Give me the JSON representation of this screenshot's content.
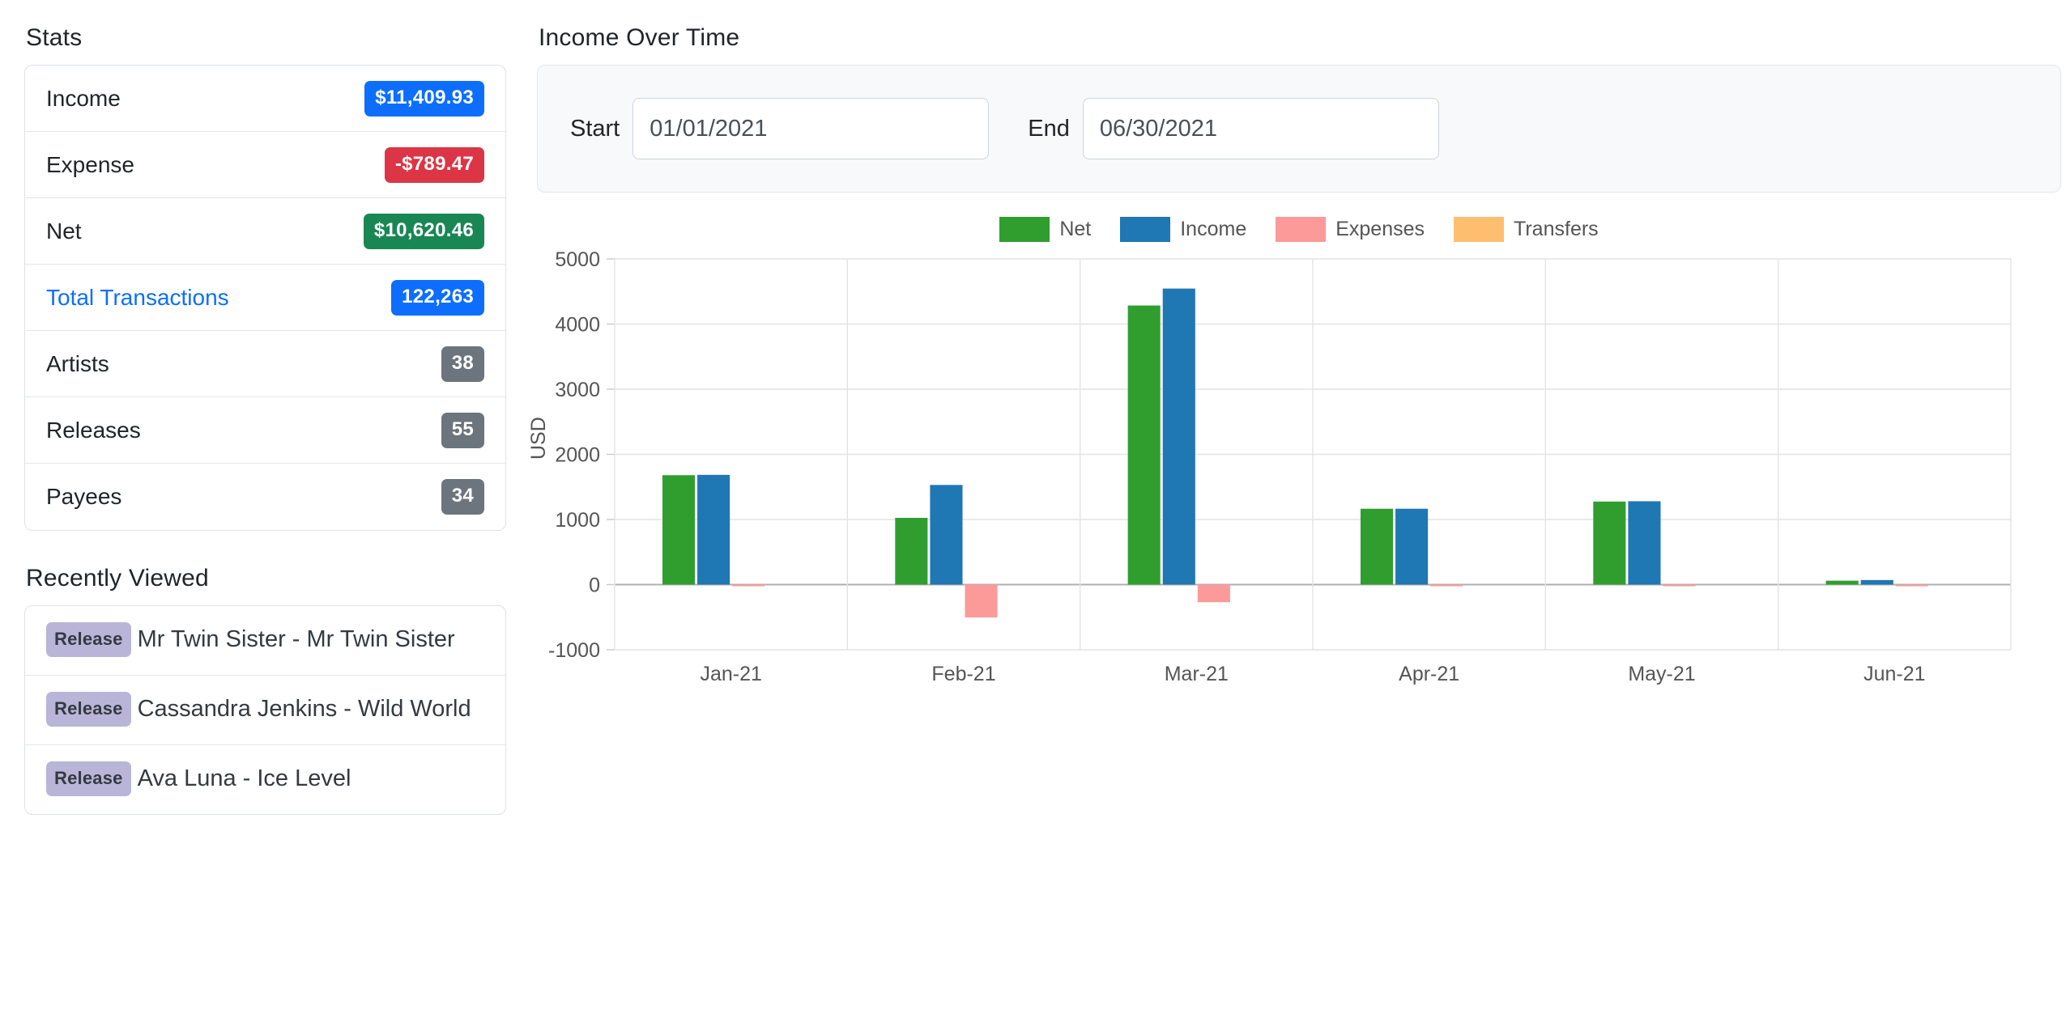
{
  "stats": {
    "title": "Stats",
    "rows": [
      {
        "label": "Income",
        "value": "$11,409.93",
        "style": "blue",
        "link": false
      },
      {
        "label": "Expense",
        "value": "-$789.47",
        "style": "red",
        "link": false
      },
      {
        "label": "Net",
        "value": "$10,620.46",
        "style": "green",
        "link": false
      },
      {
        "label": "Total Transactions",
        "value": "122,263",
        "style": "blue",
        "link": true
      },
      {
        "label": "Artists",
        "value": "38",
        "style": "gray",
        "link": false
      },
      {
        "label": "Releases",
        "value": "55",
        "style": "gray",
        "link": false
      },
      {
        "label": "Payees",
        "value": "34",
        "style": "gray",
        "link": false
      }
    ]
  },
  "recent": {
    "title": "Recently Viewed",
    "items": [
      {
        "tag": "Release",
        "text": "Mr Twin Sister - Mr Twin Sister"
      },
      {
        "tag": "Release",
        "text": "Cassandra Jenkins - Wild World"
      },
      {
        "tag": "Release",
        "text": "Ava Luna - Ice Level"
      }
    ]
  },
  "chart_panel": {
    "title": "Income Over Time",
    "filters": {
      "start_label": "Start",
      "start_value": "01/01/2021",
      "start_placeholder": "mm/dd/yyyy",
      "end_label": "End",
      "end_value": "06/30/2021",
      "end_placeholder": "mm/dd/yyyy"
    }
  },
  "chart_data": {
    "type": "bar",
    "title": "Income Over Time",
    "xlabel": "",
    "ylabel": "USD",
    "ylim": [
      -1000,
      5000
    ],
    "yticks": [
      "-1000",
      "0",
      "1000",
      "2000",
      "3000",
      "4000",
      "5000"
    ],
    "grid": true,
    "legend_position": "top-center",
    "categories": [
      "Jan-21",
      "Feb-21",
      "Mar-21",
      "Apr-21",
      "May-21",
      "Jun-21"
    ],
    "series": [
      {
        "name": "Net",
        "color": "#2f9e2f",
        "values": [
          1680,
          1025,
          4285,
          1165,
          1275,
          60
        ]
      },
      {
        "name": "Income",
        "color": "#1f77b4",
        "values": [
          1685,
          1530,
          4545,
          1165,
          1280,
          70
        ]
      },
      {
        "name": "Expenses",
        "color": "#fb9a99",
        "values": [
          -5,
          -505,
          -270,
          -5,
          -5,
          -10
        ]
      },
      {
        "name": "Transfers",
        "color": "#fdbf6f",
        "values": [
          0,
          0,
          0,
          0,
          0,
          0
        ]
      }
    ]
  },
  "colors": {
    "accent_blue": "#0d6efd",
    "danger_red": "#dc3545",
    "success_green": "#198754",
    "muted_gray": "#6c757d",
    "tag_purple": "#b9b5d9"
  }
}
